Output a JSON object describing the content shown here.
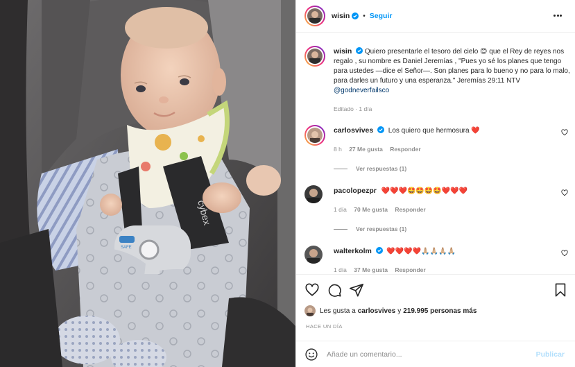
{
  "colors": {
    "accent": "#0095f6",
    "text": "#262626",
    "muted": "#8e8e8e",
    "link": "#00376b",
    "verified": "#0095f6",
    "heart": "#ed4956",
    "publish_disabled": "#b2dffc"
  },
  "header": {
    "username": "wisin",
    "separator": "•",
    "follow_label": "Seguir",
    "more_icon": "more-horizontal-icon"
  },
  "caption": {
    "username": "wisin",
    "text_before_emoji": "Quiero presentarle el tesoro del cielo",
    "emoji": "😊",
    "text_after_emoji": "que el Rey de reyes nos regalo , su nombre es Daniel Jeremías , \"Pues yo sé los planes que tengo para ustedes —dice el Señor—. Son planes para lo bueno y no para lo malo, para darles un futuro y una esperanza.\" Jeremías 29:11 NTV",
    "mention": "@godneverfailsco",
    "edited": "Editado",
    "time": "1 día"
  },
  "comments": [
    {
      "username": "carlosvives",
      "verified": true,
      "text": "Los quiero que hermosura",
      "emojis": "❤️",
      "time": "8 h",
      "likes": "27 Me gusta",
      "reply": "Responder",
      "view_replies": "Ver respuestas (1)"
    },
    {
      "username": "pacolopezpr",
      "verified": false,
      "text": "",
      "emojis": "❤️❤️❤️🤩🤩🤩🤩❤️❤️❤️",
      "time": "1 día",
      "likes": "70 Me gusta",
      "reply": "Responder",
      "view_replies": "Ver respuestas (1)"
    },
    {
      "username": "walterkolm",
      "verified": true,
      "text": "",
      "emojis": "❤️❤️❤️❤️🙏🏼🙏🏼🙏🏼🙏🏼",
      "time": "1 día",
      "likes": "37 Me gusta",
      "reply": "Responder"
    }
  ],
  "actions": {
    "like_icon": "heart-icon",
    "comment_icon": "comment-icon",
    "share_icon": "share-icon",
    "save_icon": "bookmark-icon"
  },
  "likes": {
    "prefix": "Les gusta a",
    "user": "carlosvives",
    "middle": "y",
    "count": "219.995 personas más"
  },
  "posted": "HACE UN DÍA",
  "add_comment": {
    "placeholder": "Añade un comentario...",
    "publish_label": "Publicar"
  }
}
